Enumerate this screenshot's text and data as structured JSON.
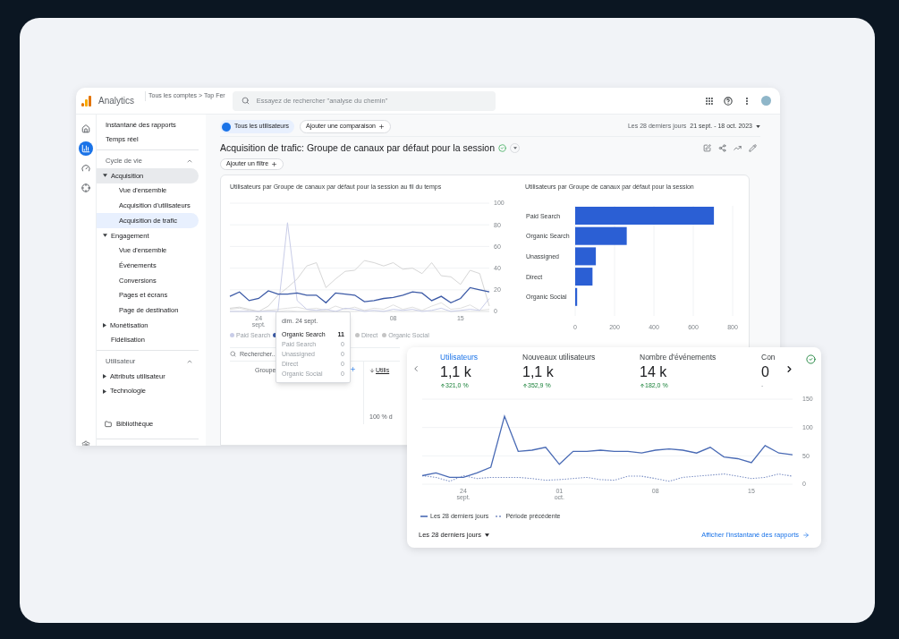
{
  "topbar": {
    "product": "Analytics",
    "breadcrumb": "Tous les comptes > Top Fer",
    "search": {
      "placeholder": "Essayez de rechercher \"analyse du chemin\""
    }
  },
  "rail": [
    {
      "kind": "home",
      "selected": false
    },
    {
      "kind": "reports",
      "selected": true
    },
    {
      "kind": "explore",
      "selected": false
    },
    {
      "kind": "advertising",
      "selected": false
    }
  ],
  "nav": {
    "top_items": [
      {
        "label": "Instantané des rapports",
        "selected": false
      },
      {
        "label": "Temps réel",
        "selected": false
      }
    ],
    "sections": [
      {
        "title": "Cycle de vie",
        "expanded": true,
        "items": [
          {
            "label": "Acquisition",
            "expanded": true,
            "highlighted": true,
            "children": [
              {
                "label": "Vue d'ensemble",
                "selected": false
              },
              {
                "label": "Acquisition d'utilisateurs",
                "selected": false
              },
              {
                "label": "Acquisition de trafic",
                "selected": true
              }
            ]
          },
          {
            "label": "Engagement",
            "expanded": true,
            "highlighted": false,
            "children": [
              {
                "label": "Vue d'ensemble",
                "selected": false
              },
              {
                "label": "Événements",
                "selected": false
              },
              {
                "label": "Conversions",
                "selected": false
              },
              {
                "label": "Pages et écrans",
                "selected": false
              },
              {
                "label": "Page de destination",
                "selected": false
              }
            ]
          },
          {
            "label": "Monétisation",
            "expanded": false,
            "highlighted": false
          },
          {
            "label": "Fidélisation",
            "highlighted": false
          }
        ]
      },
      {
        "title": "Utilisateur",
        "expanded": true,
        "items": [
          {
            "label": "Attributs utilisateur",
            "expanded": false,
            "highlighted": false
          },
          {
            "label": "Technologie",
            "expanded": false,
            "highlighted": false
          }
        ]
      }
    ],
    "library": "Bibliothèque"
  },
  "report": {
    "segment": "Tous les utilisateurs",
    "compare_chip": "Ajouter une comparaison",
    "date_range": {
      "label": "Les 28 derniers jours",
      "value": "21 sept. - 18 oct. 2023"
    },
    "title": "Acquisition de trafic: Groupe de canaux par défaut pour la session",
    "filter_chip": "Ajouter un filtre",
    "line_chart": {
      "chart_data": {
        "type": "line",
        "title": "Utilisateurs par Groupe de canaux par défaut pour la session au fil du temps",
        "grid": true,
        "categories": [
          null,
          null,
          null,
          "24 sept.",
          null,
          null,
          null,
          null,
          null,
          null,
          null,
          null,
          null,
          null,
          null,
          null,
          null,
          "08",
          null,
          null,
          null,
          null,
          null,
          null,
          "15",
          null,
          null,
          null
        ],
        "ylim": [
          0,
          100
        ],
        "yticks": [
          0,
          20,
          40,
          60,
          80,
          100
        ],
        "series": [
          {
            "name": "Organic Search",
            "color": "#3c5aa6",
            "values": [
              14,
              18,
              10,
              12,
              19,
              16,
              16,
              17,
              15,
              15,
              8,
              17,
              16,
              15,
              9,
              10,
              12,
              13,
              15,
              18,
              17,
              10,
              14,
              8,
              12,
              22,
              20,
              18
            ]
          },
          {
            "name": "Paid Search",
            "color": "#c9cde8",
            "values": [
              0,
              0,
              0,
              0,
              0,
              0,
              82,
              10,
              2,
              1,
              2,
              0,
              3,
              2,
              0,
              1,
              0,
              2,
              1,
              2,
              0,
              1,
              3,
              0,
              1,
              2,
              1,
              12
            ]
          },
          {
            "name": "Unassigned",
            "color": "#d6d6d6",
            "values": [
              3,
              4,
              2,
              0,
              5,
              15,
              22,
              30,
              42,
              45,
              22,
              30,
              37,
              38,
              47,
              45,
              42,
              45,
              39,
              40,
              35,
              45,
              33,
              32,
              25,
              38,
              35,
              5
            ]
          },
          {
            "name": "Direct",
            "color": "#e0e0e0",
            "values": [
              2,
              3,
              1,
              0,
              1,
              2,
              3,
              4,
              2,
              3,
              1,
              5,
              2,
              4,
              1,
              3,
              2,
              6,
              2,
              4,
              1,
              5,
              8,
              2,
              3,
              6,
              1,
              2
            ]
          },
          {
            "name": "Organic Social",
            "color": "#e6e6e6",
            "values": [
              0,
              0,
              0,
              0,
              1,
              0,
              1,
              0,
              0,
              1,
              0,
              0,
              0,
              0,
              1,
              0,
              0,
              0,
              0,
              0,
              1,
              0,
              0,
              0,
              0,
              0,
              0,
              0
            ]
          }
        ]
      },
      "legend_left": [
        {
          "label": "Paid Search",
          "color": "#c9cde8"
        }
      ],
      "legend_right": [
        {
          "label": "Direct",
          "color": "#c4c4c4"
        },
        {
          "label": "Organic Social",
          "color": "#c4c4c4"
        }
      ],
      "tooltip": {
        "title": "dim. 24 sept.",
        "rows": [
          {
            "value": "11",
            "highlighted": true
          },
          {
            "value": "0",
            "highlighted": false
          },
          {
            "value": "0",
            "highlighted": false
          },
          {
            "value": "0",
            "highlighted": false
          },
          {
            "value": "0",
            "highlighted": false
          }
        ]
      }
    },
    "bar_chart": {
      "chart_data": {
        "type": "bar",
        "orientation": "horizontal",
        "title": "Utilisateurs par Groupe de canaux par défaut pour la session",
        "categories": [
          "Paid Search",
          "Organic Search",
          "Unassigned",
          "Direct",
          "Organic Social"
        ],
        "values": [
          705,
          262,
          105,
          88,
          10
        ],
        "xlim": [
          0,
          800
        ],
        "xticks": [
          0,
          200,
          400,
          600,
          800
        ],
        "grid": true
      }
    },
    "table": {
      "search_placeholder": "Rechercher...",
      "columns": [
        "Groupe",
        "Utilis"
      ],
      "footer_cell": "100 % d"
    }
  },
  "summary_card": {
    "metrics": [
      {
        "label": "Utilisateurs",
        "value": "1,1 k",
        "change": "321,0 %",
        "positive": true,
        "selected": true
      },
      {
        "label": "Nouveaux utilisateurs",
        "value": "1,1 k",
        "change": "352,9 %",
        "positive": true,
        "selected": false
      },
      {
        "label": "Nombre d'événements",
        "value": "14 k",
        "change": "182,0 %",
        "positive": true,
        "selected": false
      },
      {
        "label": "Con",
        "value": "0",
        "change": "-",
        "positive": false,
        "selected": false
      }
    ],
    "chart_data": {
      "type": "line",
      "grid": true,
      "categories": [
        null,
        null,
        null,
        "24 sept.",
        null,
        null,
        null,
        null,
        null,
        null,
        "01 oct.",
        null,
        null,
        null,
        null,
        null,
        null,
        "08",
        null,
        null,
        null,
        null,
        null,
        null,
        "15",
        null,
        null,
        null
      ],
      "ylim": [
        0,
        150
      ],
      "yticks": [
        0,
        50,
        100,
        150
      ],
      "series": [
        {
          "name": "Les 28 derniers jours",
          "color": "#4a6bb5",
          "line_style": "solid",
          "values": [
            15,
            20,
            12,
            12,
            20,
            30,
            120,
            58,
            60,
            65,
            35,
            58,
            58,
            60,
            58,
            58,
            55,
            60,
            62,
            60,
            55,
            65,
            48,
            45,
            38,
            68,
            55,
            52
          ]
        },
        {
          "name": "Période précédente",
          "color": "#7b8fc4",
          "line_style": "dashed",
          "values": [
            15,
            12,
            5,
            15,
            10,
            12,
            12,
            12,
            10,
            7,
            8,
            10,
            12,
            8,
            7,
            14,
            14,
            10,
            5,
            12,
            14,
            16,
            18,
            14,
            10,
            12,
            18,
            14
          ]
        }
      ]
    },
    "period_select": "Les 28 derniers jours",
    "link": "Afficher l'instantané des rapports"
  }
}
